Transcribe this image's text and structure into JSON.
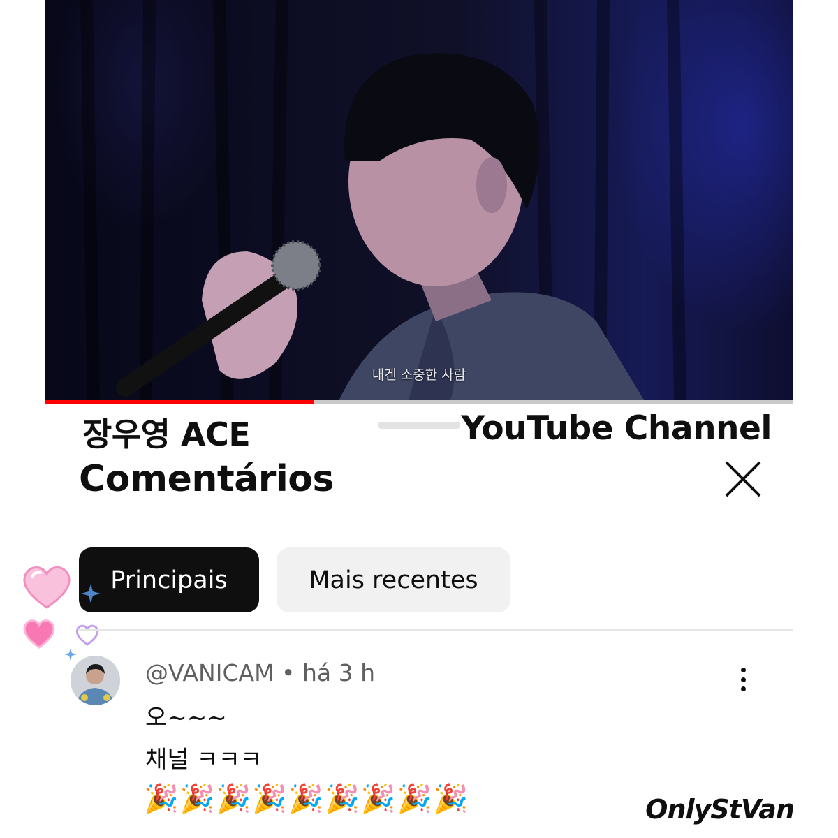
{
  "video": {
    "subtitle": "내겐 소중한 사람",
    "progress": 0.36
  },
  "overlay": {
    "left_text": "장우영 ACE",
    "right_text": "YouTube Channel"
  },
  "sheet": {
    "title": "Comentários",
    "close_icon": "close-icon"
  },
  "filters": [
    {
      "label": "Principais",
      "selected": true
    },
    {
      "label": "Mais recentes",
      "selected": false
    }
  ],
  "comment": {
    "author": "@VANICAM",
    "separator": " • ",
    "time": "há 3 h",
    "lines": [
      "오~~~",
      "채널 ㅋㅋㅋ"
    ],
    "emoji_line": "🎉🎉🎉🎉🎉🎉🎉🎉🎉",
    "menu_icon": "more-vert-icon"
  },
  "watermark": "OnlyStVan",
  "colors": {
    "progress": "#ff0000",
    "chip_active_bg": "#0f0f0f",
    "chip_inactive_bg": "#f1f1f1",
    "heart_pink": "#f7a8cf"
  }
}
